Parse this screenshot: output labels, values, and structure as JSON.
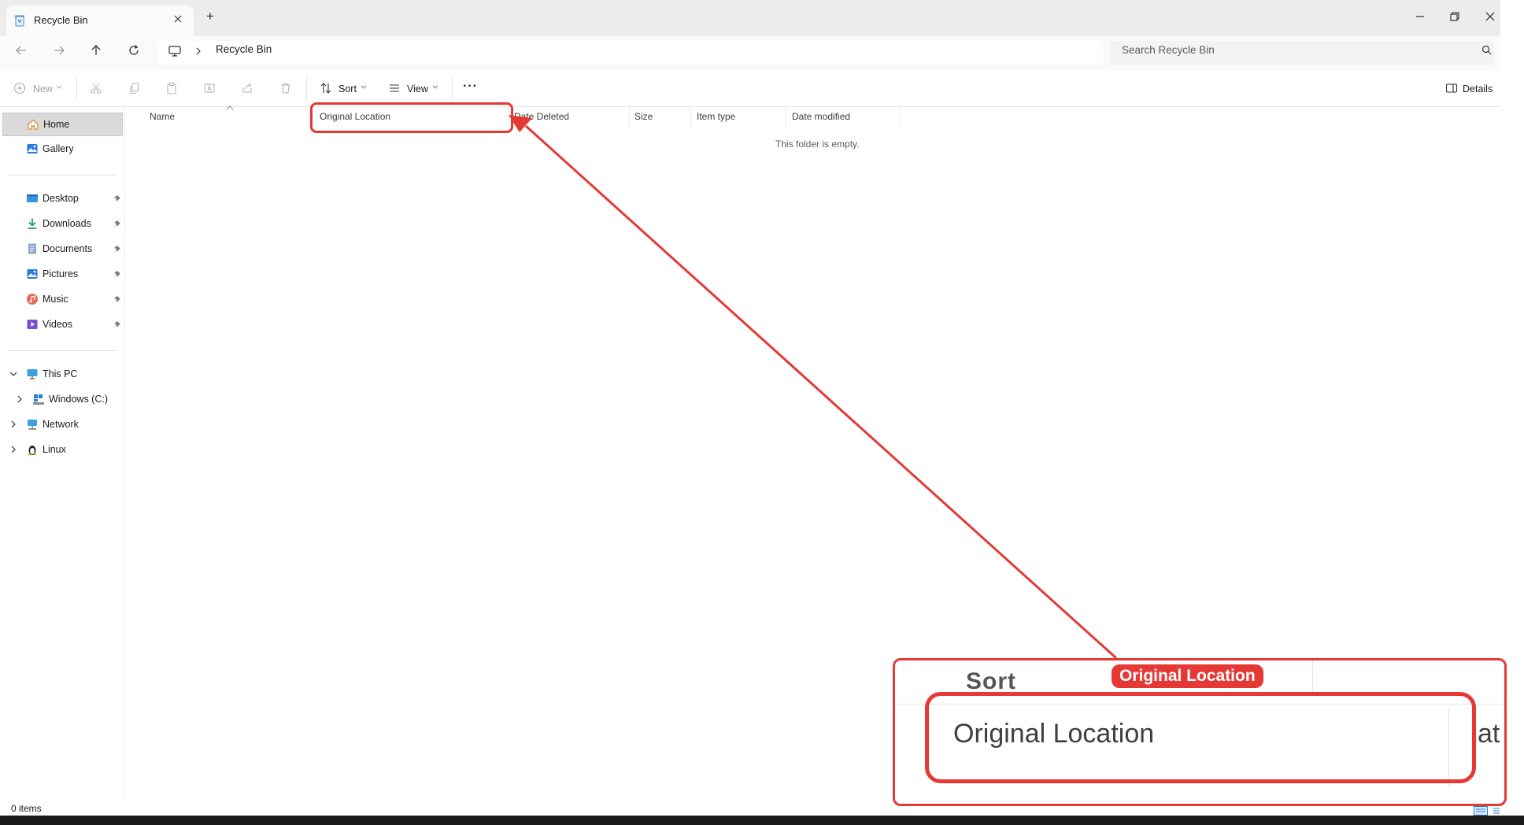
{
  "window": {
    "tab_title": "Recycle Bin",
    "new_tab_symbol": "+",
    "controls": [
      "minimize-icon",
      "restore-icon",
      "close-icon"
    ]
  },
  "address": {
    "breadcrumb": "Recycle Bin",
    "search_placeholder": "Search Recycle Bin"
  },
  "toolbar": {
    "new_label": "New",
    "sort_label": "Sort",
    "view_label": "View",
    "more_label": "···",
    "details_label": "Details"
  },
  "sidebar": {
    "top": [
      {
        "label": "Home",
        "icon": "home-icon",
        "selected": true
      },
      {
        "label": "Gallery",
        "icon": "gallery-icon"
      }
    ],
    "pinned": [
      {
        "label": "Desktop",
        "icon": "desktop-icon"
      },
      {
        "label": "Downloads",
        "icon": "downloads-icon"
      },
      {
        "label": "Documents",
        "icon": "documents-icon"
      },
      {
        "label": "Pictures",
        "icon": "pictures-icon"
      },
      {
        "label": "Music",
        "icon": "music-icon"
      },
      {
        "label": "Videos",
        "icon": "videos-icon"
      }
    ],
    "tree": [
      {
        "label": "This PC",
        "icon": "pc-icon",
        "expanded": true
      },
      {
        "label": "Windows (C:)",
        "icon": "drive-icon"
      },
      {
        "label": "Network",
        "icon": "network-icon"
      },
      {
        "label": "Linux",
        "icon": "linux-icon"
      }
    ]
  },
  "columns": [
    "Name",
    "Original Location",
    "Date Deleted",
    "Size",
    "Item type",
    "Date modified"
  ],
  "empty_message": "This folder is empty.",
  "status": {
    "item_count": "0 items"
  },
  "annotation": {
    "label": "Original Location",
    "zoom_text": "Original Location",
    "zoom_next_column": "at",
    "zoom_partial_toolbar": "Sort",
    "color": "#e53935"
  }
}
